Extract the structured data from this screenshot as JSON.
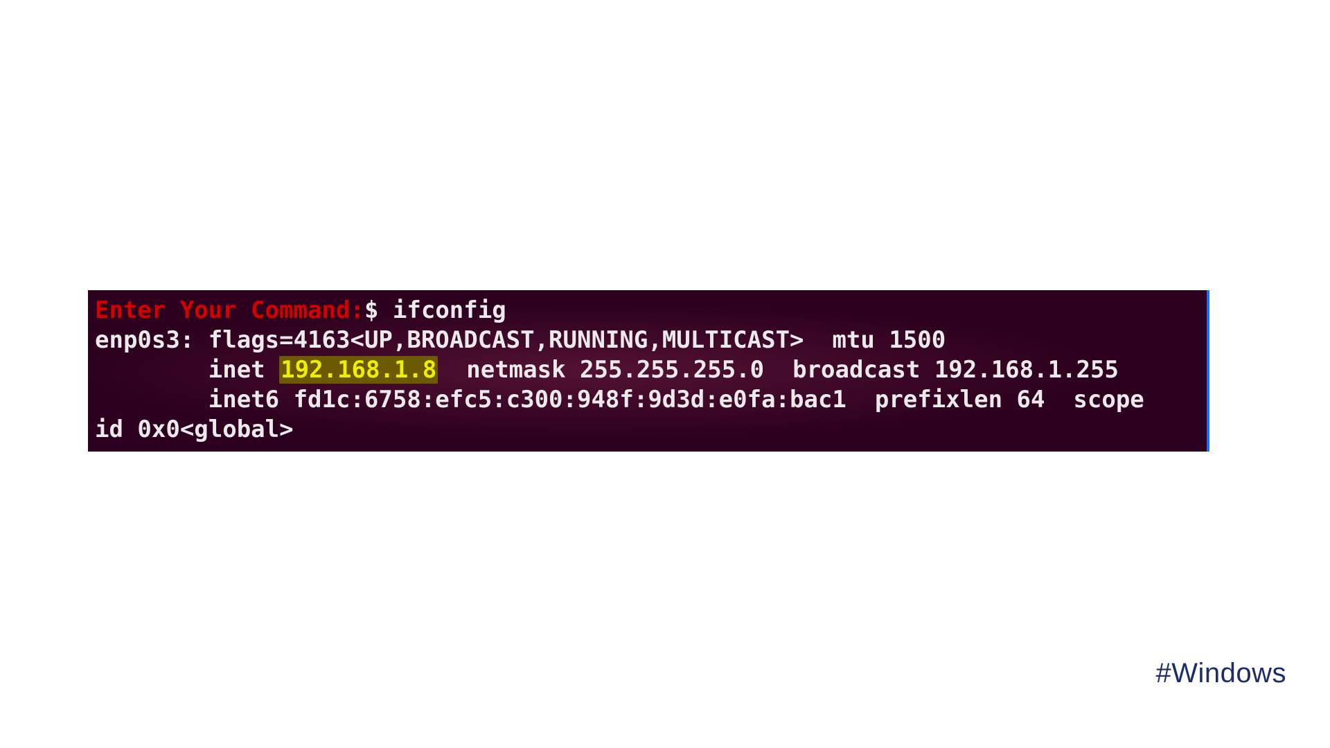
{
  "terminal": {
    "prompt_label": "Enter Your Command:",
    "prompt_symbol": "$",
    "command": "ifconfig",
    "line2_a": "enp0s3:",
    "line2_b": "flags=4163<UP,BROADCAST,RUNNING,MULTICAST>  mtu 1500",
    "inet_label": "inet",
    "ip": "192.168.1.8",
    "netmask_label": "netmask",
    "netmask_value": "255.255.255.0",
    "broadcast_label": "broadcast",
    "broadcast_value": "192.168.1.255",
    "inet6_line": "inet6 fd1c:6758:efc5:c300:948f:9d3d:e0fa:bac1  prefixlen 64  scope",
    "line5": "id 0x0<global>",
    "indent": "        "
  },
  "footer": {
    "hashtag": "#Windows"
  }
}
